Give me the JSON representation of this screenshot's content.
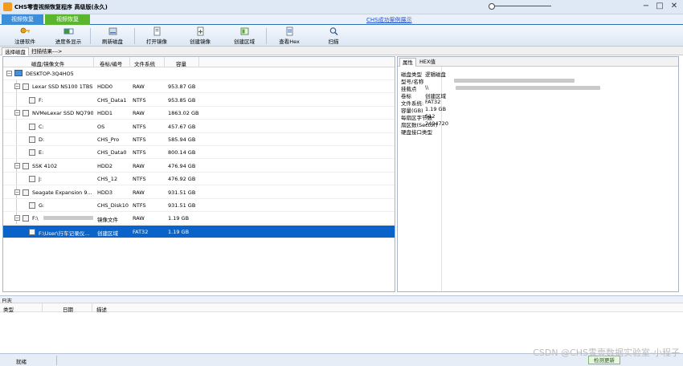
{
  "window": {
    "title": "CHS零壹视频恢复程序 高级版(永久)",
    "minimize": "−",
    "maximize": "□",
    "close": "✕"
  },
  "tabs": [
    "视频恢复",
    "视频恢复"
  ],
  "link_text": "CHS成功案例展示",
  "toolbar": [
    {
      "label": "注册软件",
      "icon": "key-icon"
    },
    {
      "label": "进度条显示",
      "icon": "progress-icon"
    },
    {
      "label": "刷新磁盘",
      "icon": "refresh-disk-icon"
    },
    {
      "label": "打开镜像",
      "icon": "open-image-icon"
    },
    {
      "label": "创建镜像",
      "icon": "create-image-icon"
    },
    {
      "label": "创建区域",
      "icon": "create-region-icon"
    },
    {
      "label": "查看Hex",
      "icon": "hex-icon"
    },
    {
      "label": "扫描",
      "icon": "scan-icon"
    }
  ],
  "subtabs": [
    "选择磁盘",
    "扫描结果--->"
  ],
  "disk_table": {
    "headers": [
      "磁盘/镜像文件",
      "卷标/编号",
      "文件系统",
      "容量"
    ],
    "rows": [
      {
        "name": "DESKTOP-3Q4HO5",
        "label": "",
        "fs": "",
        "size": "",
        "level": 0,
        "type": "pc"
      },
      {
        "name": "Lexar SSD NS100 1TBSN...",
        "label": "HDD0",
        "fs": "RAW",
        "size": "953.87 GB",
        "level": 1,
        "type": "disk"
      },
      {
        "name": "F:",
        "label": "CHS_Data1",
        "fs": "NTFS",
        "size": "953.85 GB",
        "level": 2,
        "type": "part"
      },
      {
        "name": "NVMeLexar SSD NQ790 2...",
        "label": "HDD1",
        "fs": "RAW",
        "size": "1863.02 GB",
        "level": 1,
        "type": "disk"
      },
      {
        "name": "C:",
        "label": "OS",
        "fs": "NTFS",
        "size": "457.67 GB",
        "level": 2,
        "type": "part"
      },
      {
        "name": "D:",
        "label": "CHS_Pro",
        "fs": "NTFS",
        "size": "585.94 GB",
        "level": 2,
        "type": "part"
      },
      {
        "name": "E:",
        "label": "CHS_Data0",
        "fs": "NTFS",
        "size": "800.14 GB",
        "level": 2,
        "type": "part"
      },
      {
        "name": "SSK           4102",
        "label": "HDD2",
        "fs": "RAW",
        "size": "476.94 GB",
        "level": 1,
        "type": "disk"
      },
      {
        "name": "J:",
        "label": "CHS_12",
        "fs": "NTFS",
        "size": "476.92 GB",
        "level": 2,
        "type": "part"
      },
      {
        "name": "Seagate Expansion      9...",
        "label": "HDD3",
        "fs": "RAW",
        "size": "931.51 GB",
        "level": 1,
        "type": "disk"
      },
      {
        "name": "G:",
        "label": "CHS_Disk10",
        "fs": "NTFS",
        "size": "931.51 GB",
        "level": 2,
        "type": "part"
      },
      {
        "name": "F:\\",
        "label": "镜像文件",
        "fs": "RAW",
        "size": "1.19 GB",
        "level": 1,
        "type": "image"
      },
      {
        "name": "F:\\User\\行车记录仪...",
        "label": "创建区域",
        "fs": "FAT32",
        "size": "1.19 GB",
        "level": 2,
        "type": "region",
        "selected": true
      }
    ]
  },
  "right_tabs": [
    "属性",
    "HEX值"
  ],
  "properties": [
    {
      "key": "磁盘类型",
      "value": "逻辑磁盘"
    },
    {
      "key": "型号/名称",
      "value": ""
    },
    {
      "key": "挂载点",
      "value": "\\\\"
    },
    {
      "key": "卷标",
      "value": "创建区域"
    },
    {
      "key": "文件系统:",
      "value": "FAT32"
    },
    {
      "key": "容量(GB)",
      "value": "1.19 GB"
    },
    {
      "key": "每扇区字节数",
      "value": "512"
    },
    {
      "key": "扇区数(Sector)",
      "value": "2494720"
    },
    {
      "key": "硬盘接口类型",
      "value": ""
    }
  ],
  "log": {
    "title": "日志",
    "headers": [
      "类型",
      "日期",
      "描述"
    ]
  },
  "status": {
    "ready": "就绪",
    "update_button": "检测更新"
  },
  "watermark": "CSDN @CHS零壹数据实验室-小程子"
}
